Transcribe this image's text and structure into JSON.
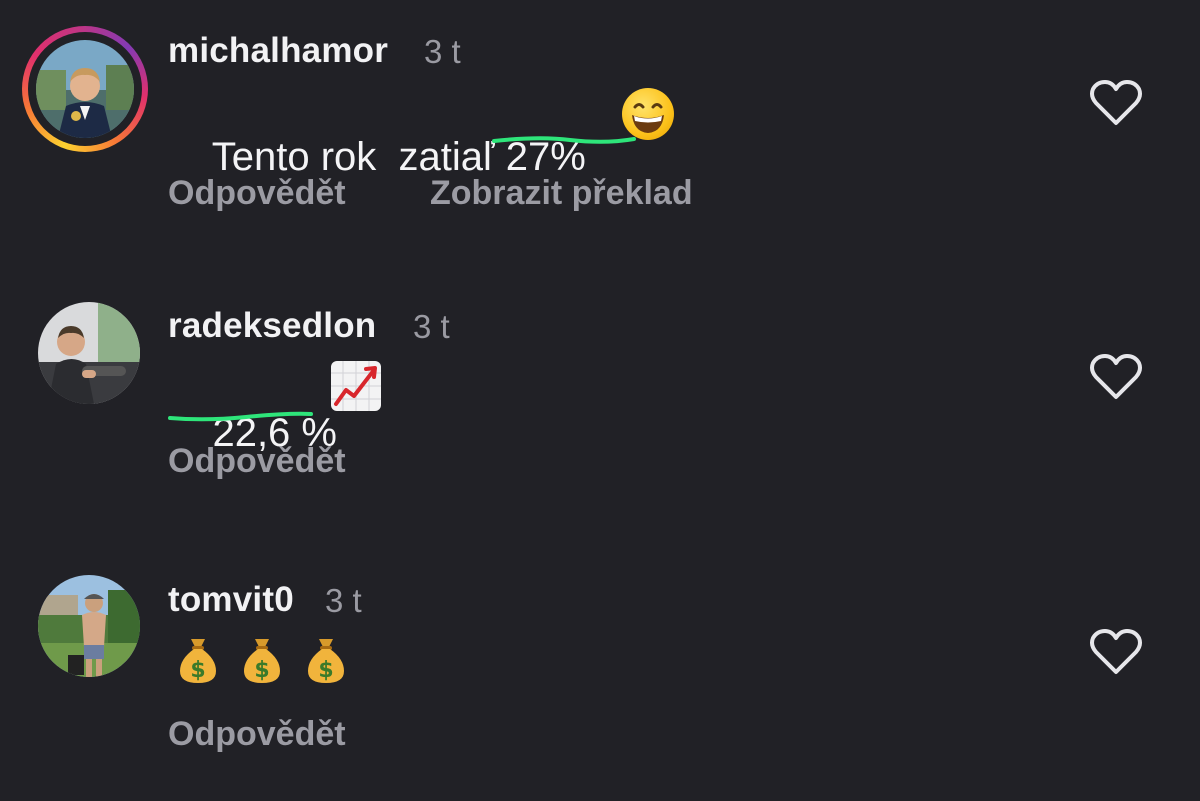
{
  "comments": [
    {
      "username": "michalhamor",
      "time": "3 t",
      "text_plain": "Tento rok  zatiaľ ",
      "text_highlight": "27%",
      "emoji": "grinning-face-with-smiling-eyes",
      "actions": [
        "Odpovědět",
        "Zobrazit překlad"
      ]
    },
    {
      "username": "radeksedlon",
      "time": "3 t",
      "text_highlight": "22,6 %",
      "emoji": "chart-increasing",
      "actions": [
        "Odpovědět"
      ]
    },
    {
      "username": "tomvit0",
      "time": "3 t",
      "emoji": "money-bag",
      "emoji_count": 3,
      "actions": [
        "Odpovědět"
      ]
    }
  ],
  "colors": {
    "background": "#212126",
    "highlight_underline": "#2ee57a",
    "secondary_text": "#9b9ba3"
  }
}
